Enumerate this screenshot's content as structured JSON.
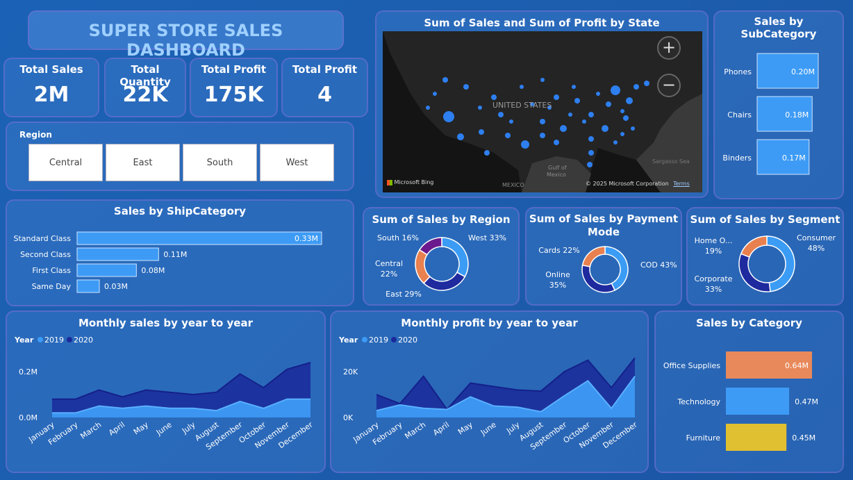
{
  "dashboard": {
    "title": "SUPER STORE SALES DASHBOARD"
  },
  "kpis": [
    {
      "label": "Total Sales",
      "value": "2M"
    },
    {
      "label": "Total Quantity",
      "value": "22K"
    },
    {
      "label": "Total Profit",
      "value": "175K"
    },
    {
      "label": "Total Profit",
      "value": "4"
    }
  ],
  "region_slicer": {
    "label": "Region",
    "options": [
      "Central",
      "East",
      "South",
      "West"
    ]
  },
  "map": {
    "title": "Sum of Sales and Sum of Profit by State",
    "country_label": "UNITED STATES",
    "mexico_label": "MEXICO",
    "gulf_label": "Gulf of\nMexico",
    "sargasso_label": "Sargasso Sea",
    "attribution": "Microsoft Bing",
    "copyright": "© 2025 Microsoft Corporation",
    "terms": "Terms",
    "zoom_in": "+",
    "zoom_out": "−",
    "colors": {
      "land": "#1b1b1b",
      "bubble": "#2e7ff0"
    }
  },
  "chart_data": [
    {
      "id": "subcategory",
      "type": "bar",
      "title": "Sales by SubCategory",
      "categories": [
        "Phones",
        "Chairs",
        "Binders"
      ],
      "values": [
        0.2,
        0.18,
        0.17
      ],
      "labels": [
        "0.20M",
        "0.18M",
        "0.17M"
      ],
      "color": "#3d9bf5"
    },
    {
      "id": "shipcategory",
      "type": "bar",
      "title": "Sales by ShipCategory",
      "categories": [
        "Standard Class",
        "Second Class",
        "First Class",
        "Same Day"
      ],
      "values": [
        0.33,
        0.11,
        0.08,
        0.03
      ],
      "labels": [
        "0.33M",
        "0.11M",
        "0.08M",
        "0.03M"
      ],
      "color": "#3d9bf5"
    },
    {
      "id": "region",
      "type": "pie",
      "title": "Sum of Sales by Region",
      "slices": [
        {
          "name": "West",
          "value": 33,
          "label": "West 33%",
          "color": "#3b9cf5"
        },
        {
          "name": "East",
          "value": 29,
          "label": "East 29%",
          "color": "#1e2a9e"
        },
        {
          "name": "Central",
          "value": 22,
          "label": "Central\n22%",
          "color": "#e8804f"
        },
        {
          "name": "South",
          "value": 16,
          "label": "South 16%",
          "color": "#6b1a8e"
        }
      ]
    },
    {
      "id": "payment",
      "type": "pie",
      "title": "Sum of Sales by Payment\nMode",
      "slices": [
        {
          "name": "COD",
          "value": 43,
          "label": "COD 43%",
          "color": "#3b9cf5"
        },
        {
          "name": "Online",
          "value": 35,
          "label": "Online\n35%",
          "color": "#1e2a9e"
        },
        {
          "name": "Cards",
          "value": 22,
          "label": "Cards 22%",
          "color": "#e8804f"
        }
      ]
    },
    {
      "id": "segment",
      "type": "pie",
      "title": "Sum of Sales by Segment",
      "slices": [
        {
          "name": "Consumer",
          "value": 48,
          "label": "Consumer\n48%",
          "color": "#3b9cf5"
        },
        {
          "name": "Corporate",
          "value": 33,
          "label": "Corporate\n33%",
          "color": "#1e2a9e"
        },
        {
          "name": "Home Office",
          "value": 19,
          "label": "Home O...\n19%",
          "color": "#e8804f"
        }
      ]
    },
    {
      "id": "monthly_sales",
      "type": "area",
      "title": "Monthly sales by year to year",
      "legend_title": "Year",
      "x": [
        "January",
        "February",
        "March",
        "April",
        "May",
        "June",
        "July",
        "August",
        "September",
        "October",
        "November",
        "December"
      ],
      "series": [
        {
          "name": "2019",
          "color": "#3d9bf5",
          "values": [
            0.02,
            0.02,
            0.05,
            0.04,
            0.05,
            0.04,
            0.04,
            0.03,
            0.07,
            0.04,
            0.08,
            0.08
          ]
        },
        {
          "name": "2020",
          "color": "#1a2a9a",
          "values": [
            0.08,
            0.08,
            0.12,
            0.09,
            0.12,
            0.11,
            0.1,
            0.11,
            0.19,
            0.13,
            0.21,
            0.24
          ]
        }
      ],
      "yticks": [
        "0.0M",
        "0.2M"
      ],
      "ylim": [
        0,
        0.2
      ]
    },
    {
      "id": "monthly_profit",
      "type": "area",
      "title": "Monthly profit by year to year",
      "legend_title": "Year",
      "x": [
        "January",
        "February",
        "March",
        "April",
        "May",
        "June",
        "July",
        "August",
        "September",
        "October",
        "November",
        "December"
      ],
      "series": [
        {
          "name": "2019",
          "color": "#3d9bf5",
          "values": [
            3000,
            5500,
            4000,
            3500,
            9000,
            5000,
            4500,
            2500,
            9500,
            16000,
            4000,
            18000
          ]
        },
        {
          "name": "2020",
          "color": "#1a2a9a",
          "values": [
            10000,
            6000,
            18000,
            3500,
            15000,
            13500,
            12000,
            11500,
            20000,
            25000,
            13000,
            26000
          ]
        }
      ],
      "yticks": [
        "0K",
        "20K"
      ],
      "ylim": [
        0,
        20000
      ]
    },
    {
      "id": "category",
      "type": "bar",
      "title": "Sales by Category",
      "categories": [
        "Office Supplies",
        "Technology",
        "Furniture"
      ],
      "values": [
        0.64,
        0.47,
        0.45
      ],
      "labels": [
        "0.64M",
        "0.47M",
        "0.45M"
      ],
      "colors": [
        "#e8895b",
        "#3d9bf5",
        "#e0c030"
      ]
    }
  ]
}
